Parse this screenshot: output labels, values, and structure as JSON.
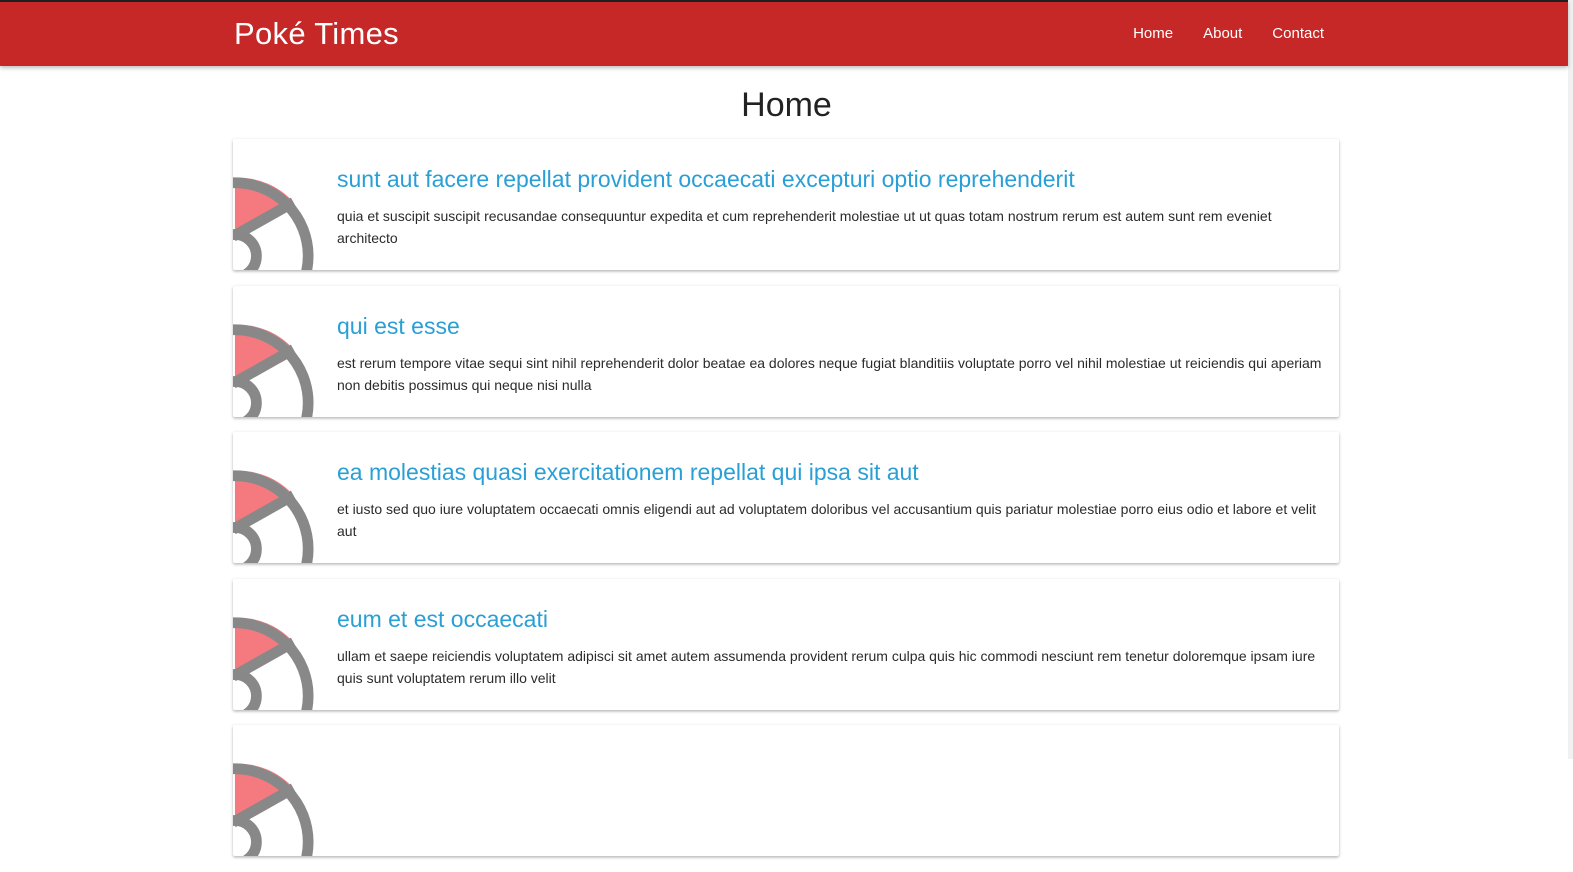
{
  "brand": {
    "colors": {
      "navbar": "#c62828",
      "link": "#2a9fd6"
    }
  },
  "nav": {
    "logo": "Poké Times",
    "links": [
      "Home",
      "About",
      "Contact"
    ]
  },
  "main": {
    "title": "Home",
    "posts": [
      {
        "title": "sunt aut facere repellat provident occaecati excepturi optio reprehenderit",
        "body": "quia et suscipit suscipit recusandae consequuntur expedita et cum reprehenderit molestiae ut ut quas totam nostrum rerum est autem sunt rem eveniet architecto"
      },
      {
        "title": "qui est esse",
        "body": "est rerum tempore vitae sequi sint nihil reprehenderit dolor beatae ea dolores neque fugiat blanditiis voluptate porro vel nihil molestiae ut reiciendis qui aperiam non debitis possimus qui neque nisi nulla"
      },
      {
        "title": "ea molestias quasi exercitationem repellat qui ipsa sit aut",
        "body": "et iusto sed quo iure voluptatem occaecati omnis eligendi aut ad voluptatem doloribus vel accusantium quis pariatur molestiae porro eius odio et labore et velit aut"
      },
      {
        "title": "eum et est occaecati",
        "body": "ullam et saepe reiciendis voluptatem adipisci sit amet autem assumenda provident rerum culpa quis hic commodi nesciunt rem tenetur doloremque ipsam iure quis sunt voluptatem rerum illo velit"
      },
      {
        "title": "",
        "body": ""
      }
    ]
  }
}
